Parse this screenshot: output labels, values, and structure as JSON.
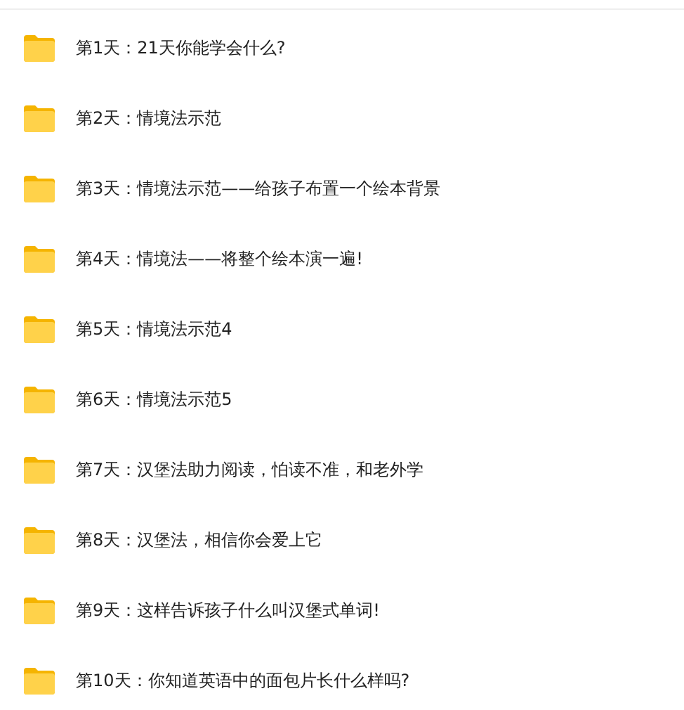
{
  "folders": [
    {
      "name": "第1天：21天你能学会什么?"
    },
    {
      "name": "第2天：情境法示范"
    },
    {
      "name": "第3天：情境法示范——给孩子布置一个绘本背景"
    },
    {
      "name": "第4天：情境法——将整个绘本演一遍!"
    },
    {
      "name": "第5天：情境法示范4"
    },
    {
      "name": "第6天：情境法示范5"
    },
    {
      "name": "第7天：汉堡法助力阅读，怕读不准，和老外学"
    },
    {
      "name": "第8天：汉堡法，相信你会爱上它"
    },
    {
      "name": "第9天：这样告诉孩子什么叫汉堡式单词!"
    },
    {
      "name": "第10天：你知道英语中的面包片长什么样吗?"
    }
  ]
}
